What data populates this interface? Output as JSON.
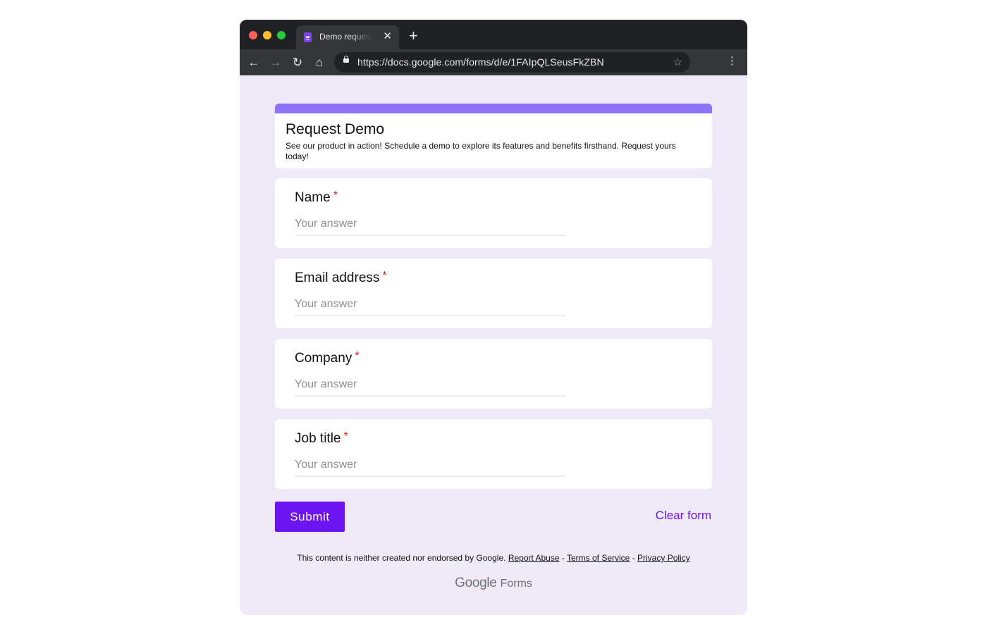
{
  "browser": {
    "tab_title": "Demo request",
    "tab_close": "✕",
    "new_tab": "+",
    "url": "https://docs.google.com/forms/d/e/1FAIpQLSeusFkZBN",
    "nav": {
      "back": "←",
      "forward": "→",
      "reload": "↻",
      "home": "⌂"
    },
    "star": "☆"
  },
  "form": {
    "title": "Request Demo",
    "description": "See our product in action! Schedule a demo to explore its features and benefits firsthand. Request yours today!",
    "accent_color": "#8d72f5",
    "questions": [
      {
        "label": "Name",
        "required_mark": "*",
        "placeholder": "Your answer",
        "value": ""
      },
      {
        "label": "Email address",
        "required_mark": "*",
        "placeholder": "Your answer",
        "value": ""
      },
      {
        "label": "Company",
        "required_mark": "*",
        "placeholder": "Your answer",
        "value": ""
      },
      {
        "label": "Job title",
        "required_mark": "*",
        "placeholder": "Your answer",
        "value": ""
      }
    ],
    "submit_label": "Submit",
    "clear_label": "Clear form",
    "button_color": "#6c14f2"
  },
  "footer": {
    "disclaimer": "This content is neither created nor endorsed by Google.",
    "report_abuse": "Report Abuse",
    "terms": "Terms of Service",
    "privacy": "Privacy Policy",
    "separator": " - ",
    "brand_google": "Google",
    "brand_forms": "Forms"
  }
}
